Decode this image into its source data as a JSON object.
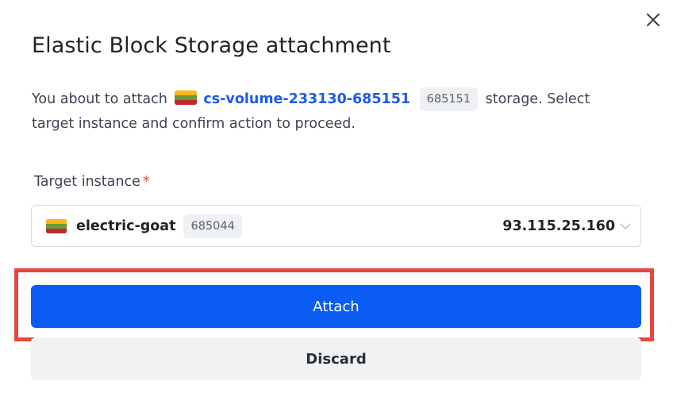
{
  "dialog": {
    "title": "Elastic Block Storage attachment",
    "close_icon": "close-icon"
  },
  "description": {
    "prefix": "You about to attach",
    "volume_flag_icon": "flag-lithuania-icon",
    "volume_name": "cs-volume-233130-685151",
    "volume_id": "685151",
    "suffix": "storage. Select target instance and confirm action to proceed."
  },
  "target_instance": {
    "label": "Target instance",
    "required_mark": "*",
    "selected": {
      "flag_icon": "flag-lithuania-icon",
      "name": "electric-goat",
      "id": "685044",
      "ip": "93.115.25.160"
    },
    "dropdown_icon": "chevron-down-icon"
  },
  "actions": {
    "attach_label": "Attach",
    "discard_label": "Discard"
  },
  "colors": {
    "primary": "#0b5cf2",
    "link": "#1d5ce6",
    "highlight": "#e8463c",
    "required": "#e5484d",
    "secondary_bg": "#f1f2f4"
  }
}
